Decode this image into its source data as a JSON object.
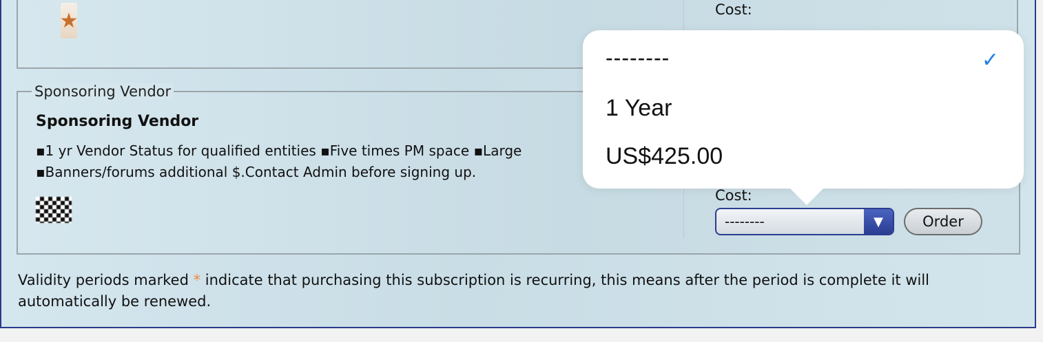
{
  "top_plan": {
    "cost_label": "Cost:"
  },
  "sponsoring": {
    "legend": "Sponsoring Vendor",
    "title": "Sponsoring Vendor",
    "desc_line1": "▪1 yr Vendor Status for qualified entities ▪Five times PM space ▪Large",
    "desc_line2": "▪Banners/forums additional $.Contact Admin before signing up.",
    "cost_label": "Cost:",
    "select_value": "--------",
    "order_label": "Order"
  },
  "footer": {
    "note_part1": "Validity periods marked ",
    "asterisk": "*",
    "note_part2": " indicate that purchasing this subscription is recurring, this means after the period is complete it will automatically be renewed."
  },
  "popover": {
    "option_placeholder": "--------",
    "option_period": "1 Year",
    "option_price": "US$425.00",
    "selected_indicator": "✓"
  },
  "icons": {
    "select_arrow": "▼",
    "star": "★"
  },
  "colors": {
    "accent_blue": "#2b3d8e",
    "check_blue": "#1f7fe6",
    "asterisk_orange": "#f08a3c"
  }
}
